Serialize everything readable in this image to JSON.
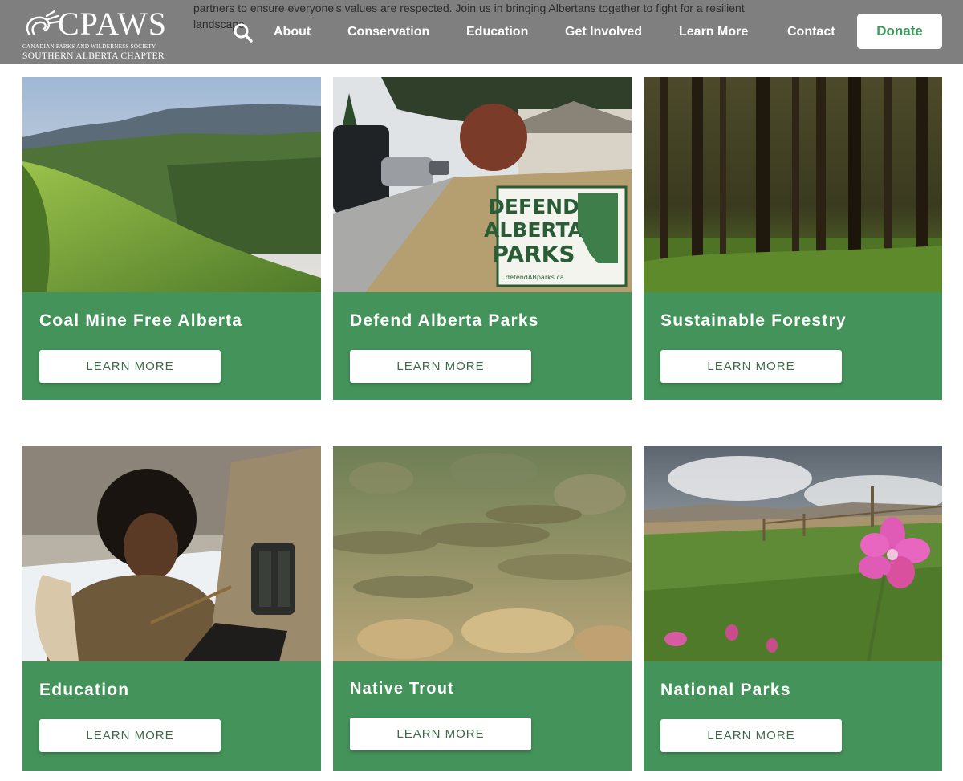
{
  "header": {
    "intro_text": "partners to ensure everyone's values are respected. Join us in bringing Albertans together to fight for a resilient landscape.",
    "logo": {
      "wordmark": "CPAWS",
      "line1": "CANADIAN PARKS AND WILDERNESS SOCIETY",
      "line2": "SOUTHERN ALBERTA CHAPTER"
    },
    "search_icon": "search-icon",
    "nav": [
      "About",
      "Conservation",
      "Education",
      "Get Involved",
      "Learn More",
      "Contact"
    ],
    "donate_label": "Donate"
  },
  "colors": {
    "header_bg": "#7f7f7f",
    "card_green": "#44935a",
    "donate_text": "#3d9a5b"
  },
  "cards": [
    {
      "title": "Coal Mine Free Alberta",
      "button": "LEARN MORE"
    },
    {
      "title": "Defend Alberta Parks",
      "button": "LEARN MORE",
      "sign_text": [
        "DEFEND",
        "ALBERTA",
        "PARKS"
      ],
      "sign_url": "defendABparks.ca"
    },
    {
      "title": "Sustainable Forestry",
      "button": "LEARN MORE"
    },
    {
      "title": "Education",
      "button": "LEARN MORE"
    },
    {
      "title": "Native Trout",
      "button": "LEARN MORE"
    },
    {
      "title": "National Parks",
      "button": "LEARN MORE"
    }
  ]
}
